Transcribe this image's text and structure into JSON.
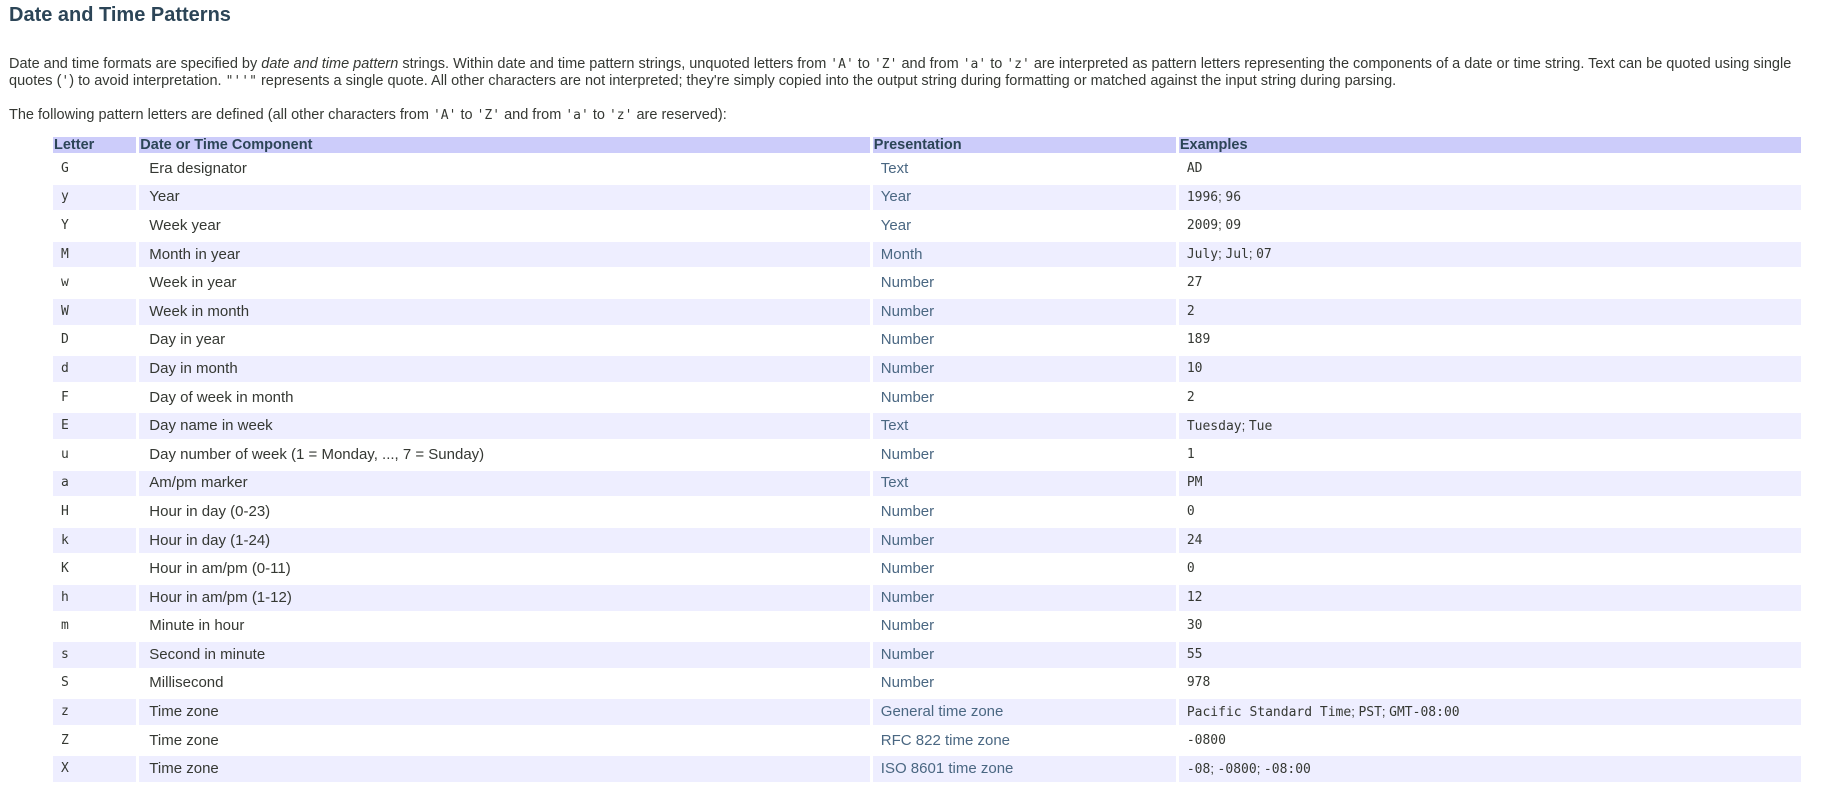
{
  "title": "Date and Time Patterns",
  "intro": {
    "p1": "Date and time formats are specified by ",
    "em": "date and time pattern",
    "p2": " strings. Within date and time pattern strings, unquoted letters from ",
    "code_A": "'A'",
    "to1": " to ",
    "code_Z": "'Z'",
    "and_from": " and from ",
    "code_a": "'a'",
    "to2": " to ",
    "code_z": "'z'",
    "p3": " are interpreted as pattern letters representing the components of a date or time string. Text can be quoted using single quotes (",
    "code_quote": "'",
    "p4": ") to avoid interpretation. ",
    "code_dq": "\"''\"",
    "p5": " represents a single quote. All other characters are not interpreted; they're simply copied into the output string during formatting or matched against the input string during parsing."
  },
  "defined": {
    "p1": "The following pattern letters are defined (all other characters from ",
    "code_A": "'A'",
    "to1": " to ",
    "code_Z": "'Z'",
    "and_from": " and from ",
    "code_a": "'a'",
    "to2": " to ",
    "code_z": "'z'",
    "p2": " are reserved):"
  },
  "table": {
    "headers": [
      "Letter",
      "Date or Time Component",
      "Presentation",
      "Examples"
    ],
    "rows": [
      {
        "letter": "G",
        "component": "Era designator",
        "presentation": "Text",
        "examples": [
          "AD"
        ]
      },
      {
        "letter": "y",
        "component": "Year",
        "presentation": "Year",
        "examples": [
          "1996",
          "96"
        ]
      },
      {
        "letter": "Y",
        "component": "Week year",
        "presentation": "Year",
        "examples": [
          "2009",
          "09"
        ]
      },
      {
        "letter": "M",
        "component": "Month in year",
        "presentation": "Month",
        "examples": [
          "July",
          "Jul",
          "07"
        ]
      },
      {
        "letter": "w",
        "component": "Week in year",
        "presentation": "Number",
        "examples": [
          "27"
        ]
      },
      {
        "letter": "W",
        "component": "Week in month",
        "presentation": "Number",
        "examples": [
          "2"
        ]
      },
      {
        "letter": "D",
        "component": "Day in year",
        "presentation": "Number",
        "examples": [
          "189"
        ]
      },
      {
        "letter": "d",
        "component": "Day in month",
        "presentation": "Number",
        "examples": [
          "10"
        ]
      },
      {
        "letter": "F",
        "component": "Day of week in month",
        "presentation": "Number",
        "examples": [
          "2"
        ]
      },
      {
        "letter": "E",
        "component": "Day name in week",
        "presentation": "Text",
        "examples": [
          "Tuesday",
          "Tue"
        ]
      },
      {
        "letter": "u",
        "component": "Day number of week (1 = Monday, ..., 7 = Sunday)",
        "presentation": "Number",
        "examples": [
          "1"
        ]
      },
      {
        "letter": "a",
        "component": "Am/pm marker",
        "presentation": "Text",
        "examples": [
          "PM"
        ]
      },
      {
        "letter": "H",
        "component": "Hour in day (0-23)",
        "presentation": "Number",
        "examples": [
          "0"
        ]
      },
      {
        "letter": "k",
        "component": "Hour in day (1-24)",
        "presentation": "Number",
        "examples": [
          "24"
        ]
      },
      {
        "letter": "K",
        "component": "Hour in am/pm (0-11)",
        "presentation": "Number",
        "examples": [
          "0"
        ]
      },
      {
        "letter": "h",
        "component": "Hour in am/pm (1-12)",
        "presentation": "Number",
        "examples": [
          "12"
        ]
      },
      {
        "letter": "m",
        "component": "Minute in hour",
        "presentation": "Number",
        "examples": [
          "30"
        ]
      },
      {
        "letter": "s",
        "component": "Second in minute",
        "presentation": "Number",
        "examples": [
          "55"
        ]
      },
      {
        "letter": "S",
        "component": "Millisecond",
        "presentation": "Number",
        "examples": [
          "978"
        ]
      },
      {
        "letter": "z",
        "component": "Time zone",
        "presentation": "General time zone",
        "examples": [
          "Pacific Standard Time",
          "PST",
          "GMT-08:00"
        ]
      },
      {
        "letter": "Z",
        "component": "Time zone",
        "presentation": "RFC 822 time zone",
        "examples": [
          "-0800"
        ]
      },
      {
        "letter": "X",
        "component": "Time zone",
        "presentation": "ISO 8601 time zone",
        "examples": [
          "-08",
          "-0800",
          "-08:00"
        ]
      }
    ]
  },
  "colors": {
    "header_bg": "#ccccfa",
    "alt_row_bg": "#eeeeff",
    "title": "#2c4557",
    "presentation_text": "#4a6782"
  }
}
